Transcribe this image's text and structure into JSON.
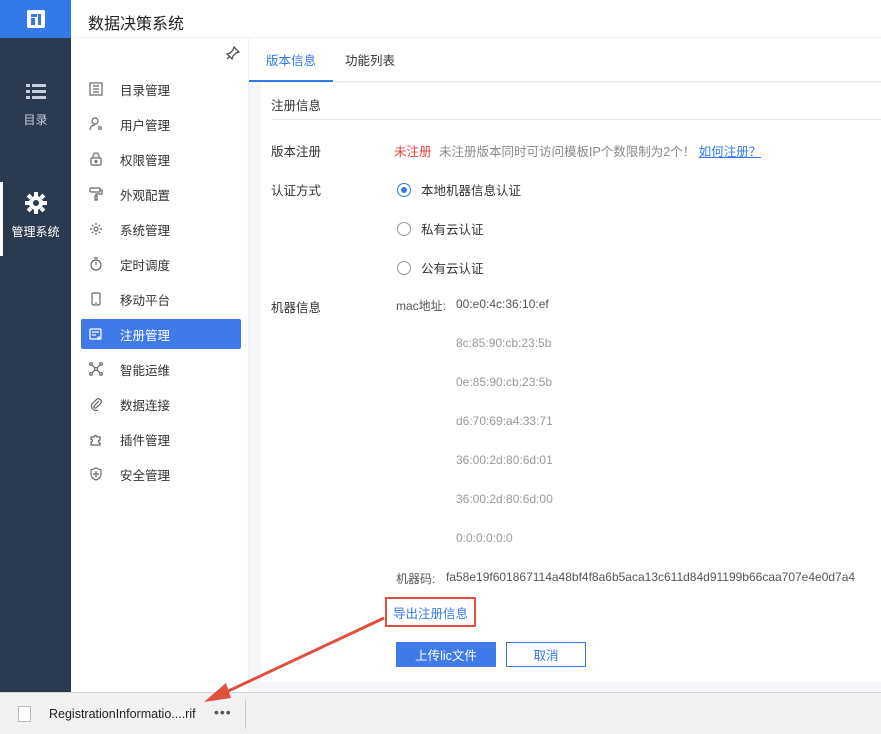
{
  "header": {
    "title": "数据决策系统"
  },
  "rail": {
    "items": [
      {
        "label": "目录"
      },
      {
        "label": "管理系统"
      }
    ]
  },
  "menu": {
    "items": [
      {
        "label": "目录管理",
        "icon": "catalog-icon"
      },
      {
        "label": "用户管理",
        "icon": "user-icon"
      },
      {
        "label": "权限管理",
        "icon": "lock-icon"
      },
      {
        "label": "外观配置",
        "icon": "paint-roller-icon"
      },
      {
        "label": "系统管理",
        "icon": "gear-icon"
      },
      {
        "label": "定时调度",
        "icon": "timer-icon"
      },
      {
        "label": "移动平台",
        "icon": "mobile-icon"
      },
      {
        "label": "注册管理",
        "icon": "register-icon"
      },
      {
        "label": "智能运维",
        "icon": "network-icon"
      },
      {
        "label": "数据连接",
        "icon": "paperclip-icon"
      },
      {
        "label": "插件管理",
        "icon": "puzzle-icon"
      },
      {
        "label": "安全管理",
        "icon": "shield-icon"
      }
    ],
    "active_index": 7
  },
  "tabs": [
    {
      "label": "版本信息",
      "active": true
    },
    {
      "label": "功能列表",
      "active": false
    }
  ],
  "panel": {
    "title": "注册信息",
    "version_label": "版本注册",
    "status": "未注册",
    "status_note": "未注册版本同时可访问模板IP个数限制为2个！",
    "how_link": "如何注册？",
    "auth_label": "认证方式",
    "auth_options": [
      {
        "label": "本地机器信息认证",
        "selected": true
      },
      {
        "label": "私有云认证",
        "selected": false
      },
      {
        "label": "公有云认证",
        "selected": false
      }
    ],
    "machine_label": "机器信息",
    "mac_label": "mac地址:",
    "macs": [
      "00:e0:4c:36:10:ef",
      "8c:85:90:cb:23:5b",
      "0e:85:90:cb:23:5b",
      "d6:70:69:a4:33:71",
      "36:00:2d:80:6d:01",
      "36:00:2d:80:6d:00",
      "0:0:0:0:0:0"
    ],
    "machine_code_label": "机器码:",
    "machine_code": "fa58e19f601867114a48bf4f8a6b5aca13c611d84d91199b66caa707e4e0d7a4",
    "export_link": "导出注册信息",
    "upload_button": "上传lic文件",
    "cancel_button": "取消"
  },
  "download": {
    "file_name": "RegistrationInformatio....rif",
    "more": "•••"
  },
  "colors": {
    "accent": "#3479e8",
    "rail": "#2c3a50",
    "highlight": "#e0503e",
    "status_red": "#e84040"
  }
}
